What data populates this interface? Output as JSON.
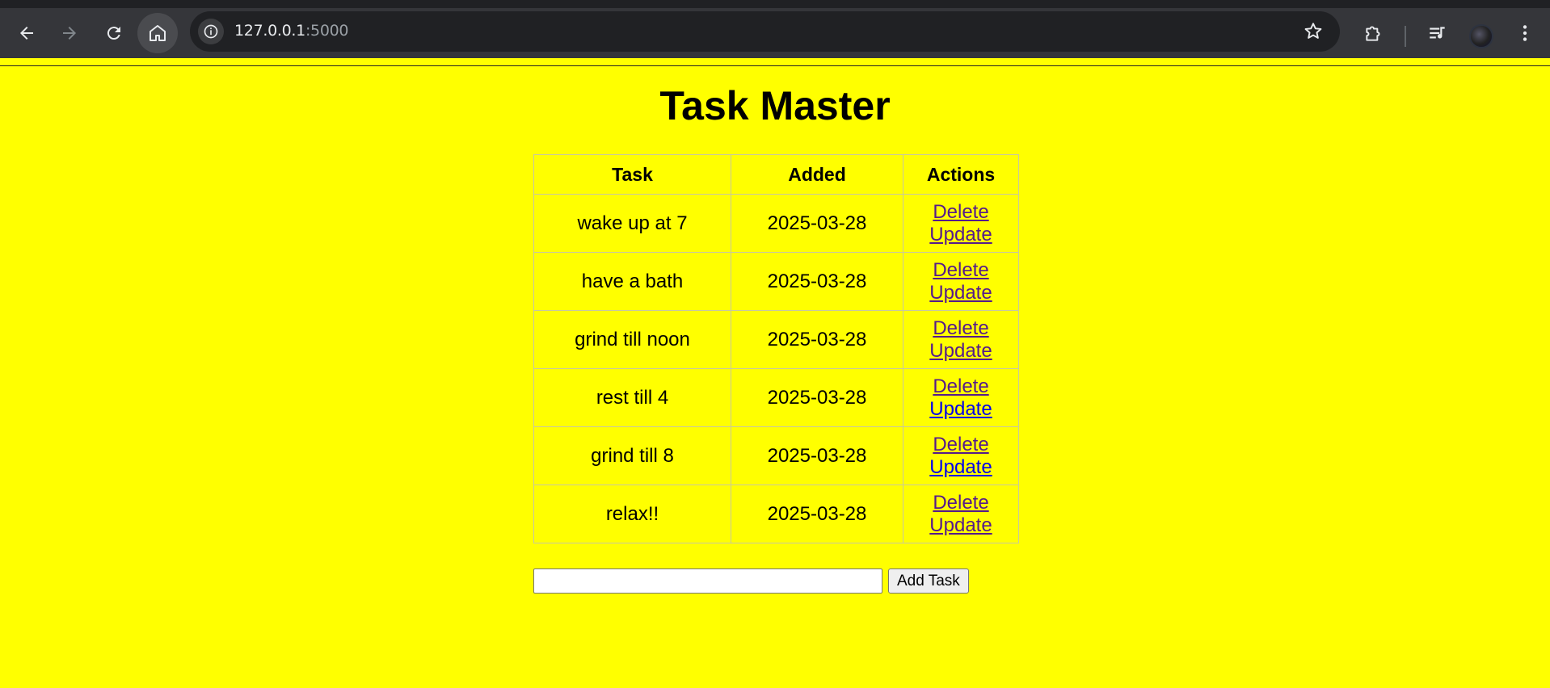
{
  "browser": {
    "url_host": "127.0.0.1",
    "url_port": ":5000",
    "icons": {
      "back": "arrow-left-icon",
      "forward": "arrow-right-icon",
      "reload": "reload-icon",
      "home": "home-icon",
      "site_info": "info-icon",
      "bookmark": "star-icon",
      "extensions": "puzzle-icon",
      "media": "media-queue-icon",
      "menu": "kebab-menu-icon"
    },
    "colors": {
      "frame": "#35363a",
      "omnibox": "#202124",
      "text": "#e8eaed"
    }
  },
  "page": {
    "title": "Task Master",
    "background_color": "#ffff00",
    "table": {
      "headers": [
        "Task",
        "Added",
        "Actions"
      ],
      "rows": [
        {
          "task": "wake up at 7",
          "added": "2025-03-28",
          "delete_label": "Delete",
          "update_label": "Update",
          "delete_visited": true,
          "update_visited": true
        },
        {
          "task": "have a bath",
          "added": "2025-03-28",
          "delete_label": "Delete",
          "update_label": "Update",
          "delete_visited": true,
          "update_visited": true
        },
        {
          "task": "grind till noon",
          "added": "2025-03-28",
          "delete_label": "Delete",
          "update_label": "Update",
          "delete_visited": true,
          "update_visited": true
        },
        {
          "task": "rest till 4",
          "added": "2025-03-28",
          "delete_label": "Delete",
          "update_label": "Update",
          "delete_visited": true,
          "update_visited": false
        },
        {
          "task": "grind till 8",
          "added": "2025-03-28",
          "delete_label": "Delete",
          "update_label": "Update",
          "delete_visited": true,
          "update_visited": false
        },
        {
          "task": "relax!!",
          "added": "2025-03-28",
          "delete_label": "Delete",
          "update_label": "Update",
          "delete_visited": true,
          "update_visited": true
        }
      ]
    },
    "form": {
      "input_value": "",
      "input_placeholder": "",
      "submit_label": "Add Task"
    },
    "link_colors": {
      "visited": "#551a8b",
      "unvisited": "#0000ee"
    }
  }
}
